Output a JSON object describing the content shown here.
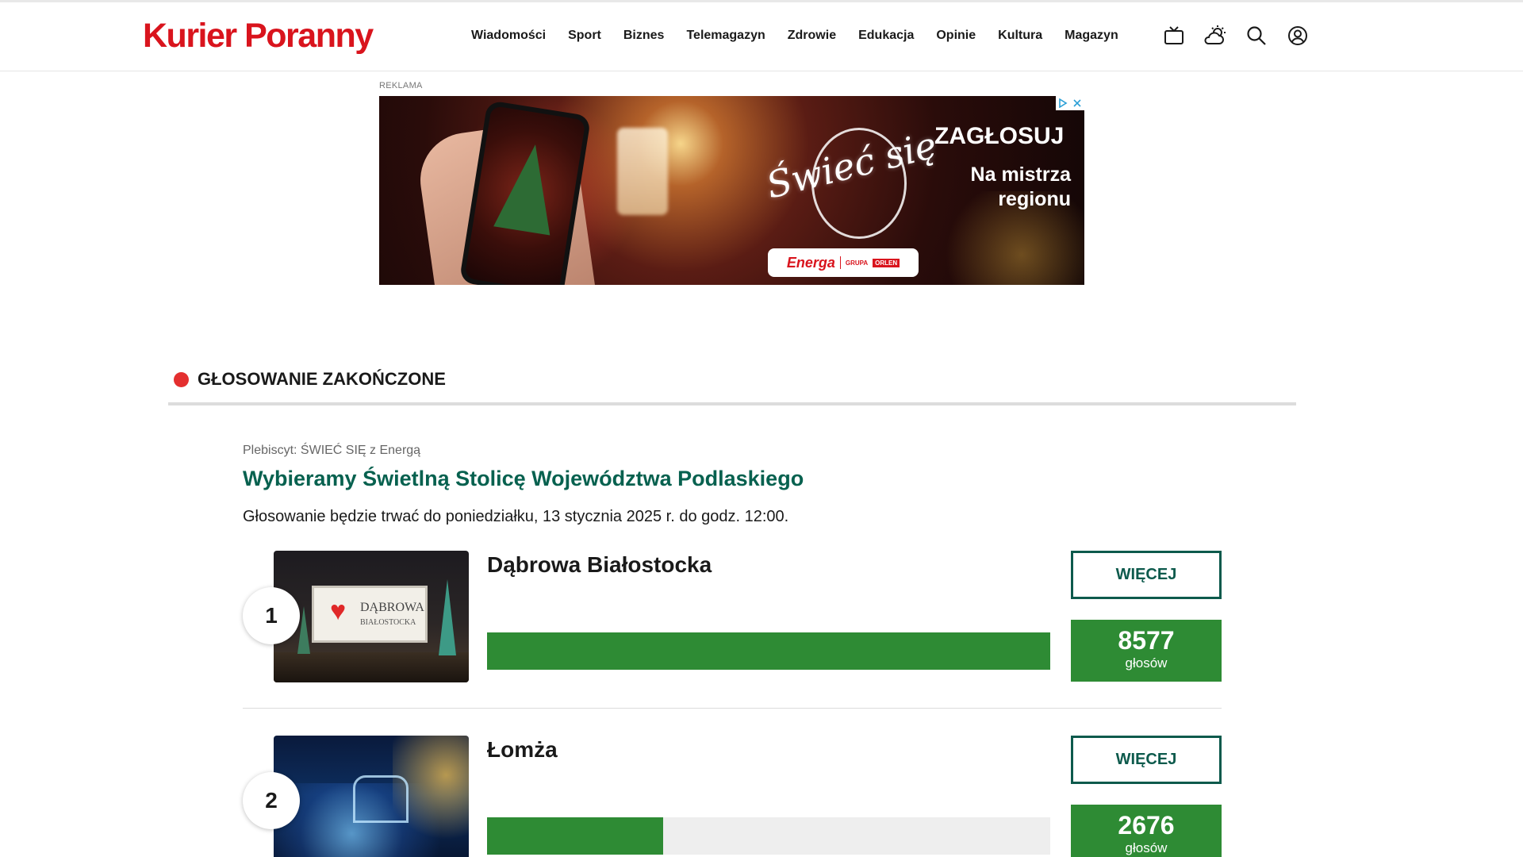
{
  "header": {
    "logo": "Kurier Poranny",
    "nav": [
      "Wiadomości",
      "Sport",
      "Biznes",
      "Telemagazyn",
      "Zdrowie",
      "Edukacja",
      "Opinie",
      "Kultura",
      "Magazyn"
    ],
    "icons": [
      "tv-icon",
      "weather-icon",
      "search-icon",
      "user-icon"
    ]
  },
  "ad": {
    "label": "REKLAMA",
    "script_text": "Świeć się",
    "headline": "ZAGŁOSUJ",
    "subline": "Na mistrza regionu",
    "sponsor": "Energa",
    "sponsor_group": "GRUPA",
    "sponsor_orlen": "ORLEN"
  },
  "section": {
    "title": "GŁOSOWANIE ZAKOŃCZONE",
    "status_color": "#e42f2f"
  },
  "poll": {
    "plebiscite": "Plebiscyt: ŚWIEĆ SIĘ z Energą",
    "title": "Wybieramy Świetlną Stolicę Województwa Podlaskiego",
    "note": "Głosowanie będzie trwać do poniedziałku, 13 stycznia 2025 r. do godz. 12:00.",
    "accent_color": "#07614f",
    "bar_color": "#2e8b34"
  },
  "entries": [
    {
      "rank": "1",
      "name": "Dąbrowa Białostocka",
      "more": "WIĘCEJ",
      "votes": "8577",
      "votes_label": "głosów",
      "share": 1.0,
      "thumb_sign": "DĄBROWA",
      "thumb_sign_sub": "BIAŁOSTOCKA"
    },
    {
      "rank": "2",
      "name": "Łomża",
      "more": "WIĘCEJ",
      "votes": "2676",
      "votes_label": "głosów",
      "share": 0.312
    }
  ]
}
